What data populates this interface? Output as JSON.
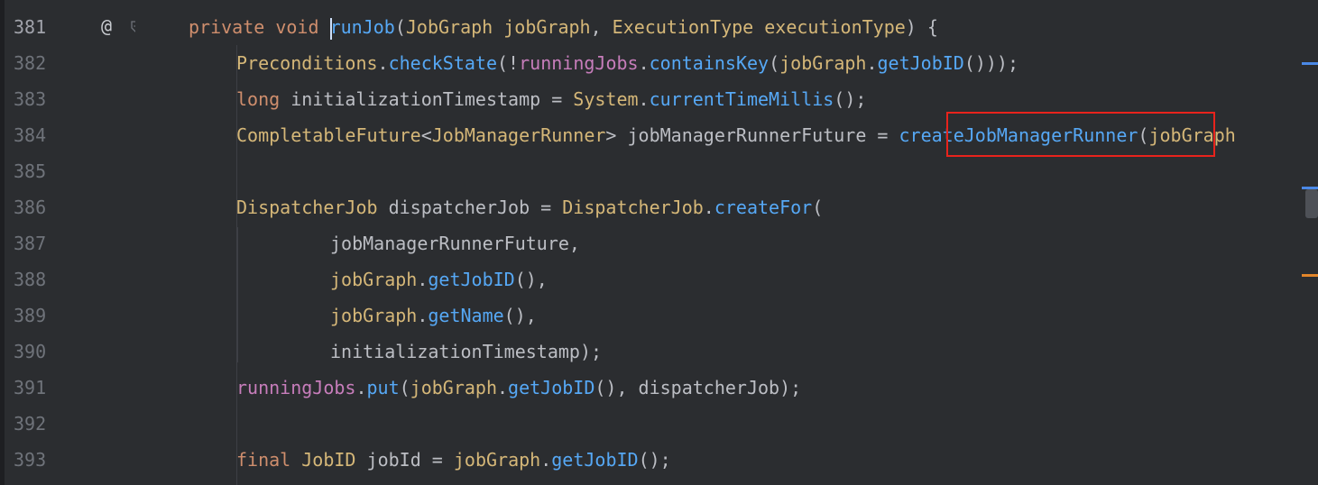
{
  "editor": {
    "gutter": {
      "override_marker": "@",
      "line_numbers": [
        "381",
        "382",
        "383",
        "384",
        "385",
        "386",
        "387",
        "388",
        "389",
        "390",
        "391",
        "392",
        "393"
      ]
    },
    "lines": {
      "l381": {
        "kw1": "private",
        "kw2": "void",
        "method": "runJob",
        "p1": "(",
        "type1": "JobGraph",
        "param1": "jobGraph",
        "p2": ", ",
        "type2": "ExecutionType",
        "param2": "executionType",
        "p3": ") {"
      },
      "l382": {
        "cls": "Preconditions",
        "dot1": ".",
        "m1": "checkState",
        "p1": "(!",
        "fld": "runningJobs",
        "dot2": ".",
        "m2": "containsKey",
        "p2": "(",
        "var": "jobGraph",
        "dot3": ".",
        "m3": "getJobID",
        "p3": "()));"
      },
      "l383": {
        "kw": "long",
        "name": " initializationTimestamp = ",
        "cls": "System",
        "dot": ".",
        "m": "currentTimeMillis",
        "p": "();"
      },
      "l384": {
        "cls1": "CompletableFuture",
        "lt": "<",
        "cls2": "JobManagerRunner",
        "gt": "> jobManagerRunnerFuture = ",
        "m": "createJobManagerRunner",
        "p": "(",
        "var": "jobGraph"
      },
      "l386": {
        "cls1": "DispatcherJob",
        "name": " dispatcherJob = ",
        "cls2": "DispatcherJob",
        "dot": ".",
        "m": "createFor",
        "p": "("
      },
      "l387": {
        "text": "jobManagerRunnerFuture,"
      },
      "l388": {
        "var": "jobGraph",
        "dot": ".",
        "m": "getJobID",
        "p": "(),"
      },
      "l389": {
        "var": "jobGraph",
        "dot": ".",
        "m": "getName",
        "p": "(),"
      },
      "l390": {
        "text": "initializationTimestamp);"
      },
      "l391": {
        "fld": "runningJobs",
        "dot1": ".",
        "m1": "put",
        "p1": "(",
        "var": "jobGraph",
        "dot2": ".",
        "m2": "getJobID",
        "p2": "(), dispatcherJob);"
      },
      "l393": {
        "kw": "final",
        "cls": "JobID",
        "name": " jobId = ",
        "var": "jobGraph",
        "dot": ".",
        "m": "getJobID",
        "p": "();"
      }
    }
  },
  "colors": {
    "background": "#2b2d30",
    "keyword": "#cf8e6d",
    "class": "#d5b778",
    "field": "#c77dbb",
    "method": "#56a8f5",
    "plain": "#bcbec4",
    "highlight_box": "#e8231c"
  }
}
